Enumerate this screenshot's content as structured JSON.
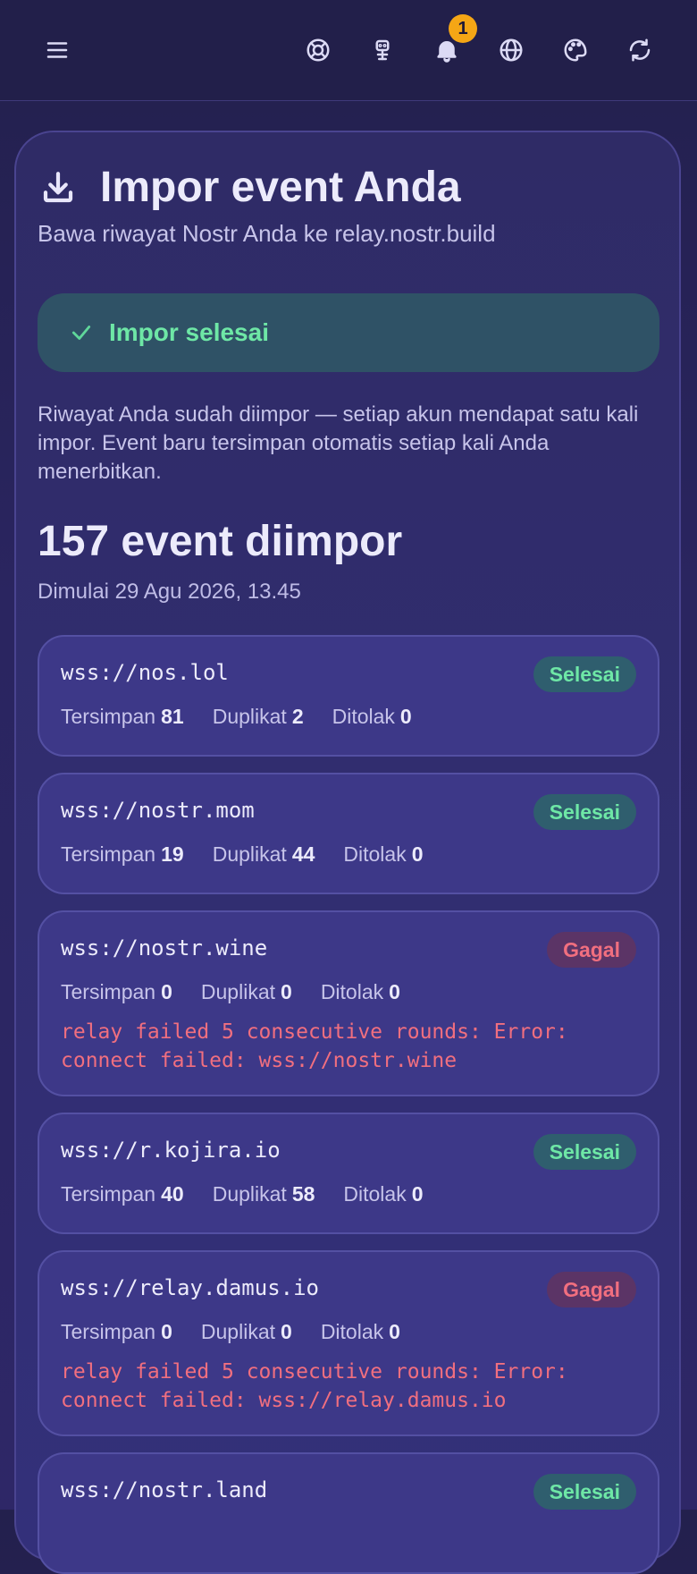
{
  "header": {
    "notification_count": "1",
    "icons": [
      "menu-icon",
      "lifebuoy-icon",
      "robot-icon",
      "bell-icon",
      "globe-icon",
      "palette-icon",
      "refresh-icon"
    ]
  },
  "import": {
    "title": "Impor event Anda",
    "subtitle": "Bawa riwayat Nostr Anda ke relay.nostr.build",
    "success_label": "Impor selesai",
    "description": "Riwayat Anda sudah diimpor — setiap akun mendapat satu kali impor. Event baru tersimpan otomatis setiap kali Anda menerbitkan.",
    "count_label": "157 event diimpor",
    "started_label": "Dimulai 29 Agu 2026, 13.45"
  },
  "labels": {
    "saved": "Tersimpan",
    "duplicate": "Duplikat",
    "rejected": "Ditolak"
  },
  "relays": [
    {
      "url": "wss://nos.lol",
      "status": "Selesai",
      "ok": true,
      "saved": "81",
      "duplicate": "2",
      "rejected": "0",
      "error": ""
    },
    {
      "url": "wss://nostr.mom",
      "status": "Selesai",
      "ok": true,
      "saved": "19",
      "duplicate": "44",
      "rejected": "0",
      "error": ""
    },
    {
      "url": "wss://nostr.wine",
      "status": "Gagal",
      "ok": false,
      "saved": "0",
      "duplicate": "0",
      "rejected": "0",
      "error": "relay failed 5 consecutive rounds: Error: connect failed: wss://nostr.wine"
    },
    {
      "url": "wss://r.kojira.io",
      "status": "Selesai",
      "ok": true,
      "saved": "40",
      "duplicate": "58",
      "rejected": "0",
      "error": ""
    },
    {
      "url": "wss://relay.damus.io",
      "status": "Gagal",
      "ok": false,
      "saved": "0",
      "duplicate": "0",
      "rejected": "0",
      "error": "relay failed 5 consecutive rounds: Error: connect failed: wss://relay.damus.io"
    },
    {
      "url": "wss://nostr.land",
      "status": "Selesai",
      "ok": true,
      "saved": "",
      "duplicate": "",
      "rejected": "",
      "error": ""
    }
  ],
  "colors": {
    "success": "#6ee7a6",
    "failure": "#f16f7f",
    "badge": "#f5a615"
  }
}
